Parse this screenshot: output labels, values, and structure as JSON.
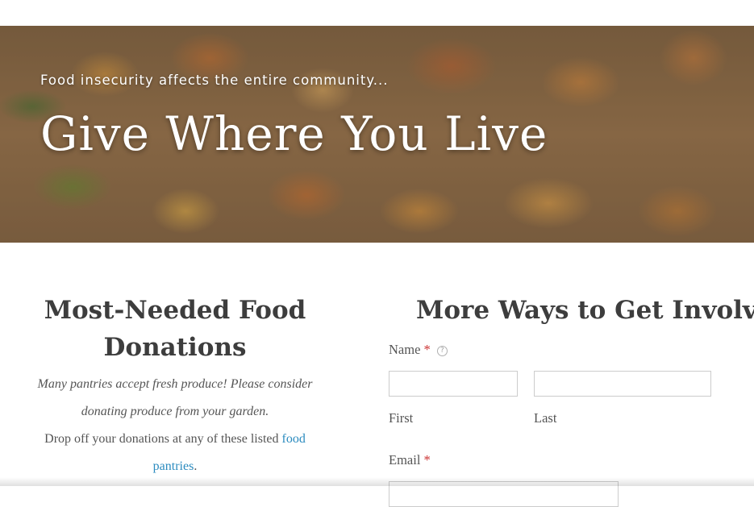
{
  "hero": {
    "tagline": "Food insecurity affects the entire community...",
    "title": "Give Where You Live"
  },
  "donations": {
    "heading_line1": "Most-Needed Food",
    "heading_line2": "Donations",
    "italic_line1": "Many pantries accept fresh produce!  Please consider",
    "italic_line2": "donating produce from your garden.",
    "drop_off_text": "Drop off your donations at any of these listed ",
    "link_word1": "food",
    "link_word2": "pantries",
    "period": "."
  },
  "form": {
    "heading": "More Ways to Get Involved",
    "name_label": "Name",
    "required_mark": "*",
    "help_icon_glyph": "?",
    "first_label": "First",
    "last_label": "Last",
    "email_label": "Email",
    "first_value": "",
    "last_value": "",
    "email_value": ""
  },
  "colors": {
    "link": "#2b8bbf",
    "required": "#cc3333",
    "heading": "#3d3d3d"
  }
}
